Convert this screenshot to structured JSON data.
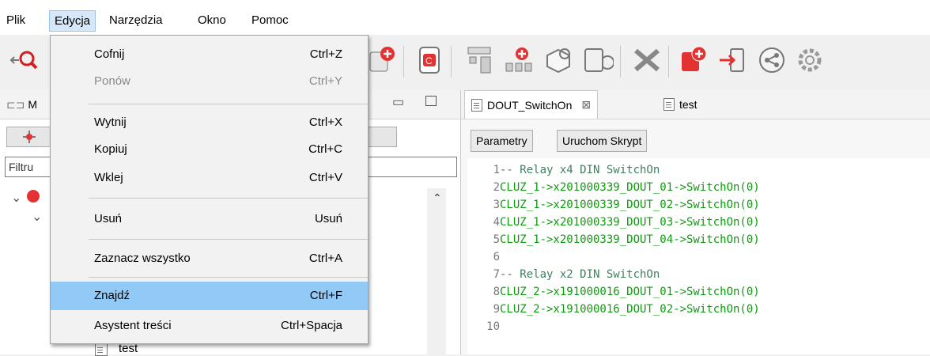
{
  "menubar": {
    "items": [
      "Plik",
      "Edycja",
      "Narzędzia",
      "Okno",
      "Pomoc"
    ]
  },
  "colors": {
    "menu_highlight": "#91c9f7",
    "code_green": "#0f9b0f",
    "comment_green": "#3f7f5f",
    "accent_red": "#e23232"
  },
  "toolbar": {
    "icons": [
      "search-tool-icon",
      "add-device-icon",
      "controller-icon",
      "modules-icon",
      "network-icon",
      "cube-settings-icon",
      "device-sync-icon",
      "remove-icon",
      "add-object-icon",
      "import-icon",
      "share-cloud-icon",
      "settings-icon"
    ]
  },
  "left_panel": {
    "tab_label": "M",
    "filter_label": "Filtru",
    "tree_item_label": "test"
  },
  "edit_menu": {
    "items": [
      {
        "label": "Cofnij",
        "shortcut": "Ctrl+Z",
        "enabled": true
      },
      {
        "label": "Ponów",
        "shortcut": "Ctrl+Y",
        "enabled": false
      },
      {
        "label": "Wytnij",
        "shortcut": "Ctrl+X",
        "enabled": true
      },
      {
        "label": "Kopiuj",
        "shortcut": "Ctrl+C",
        "enabled": true
      },
      {
        "label": "Wklej",
        "shortcut": "Ctrl+V",
        "enabled": true
      },
      {
        "label": "Usuń",
        "shortcut": "Usuń",
        "enabled": true
      },
      {
        "label": "Zaznacz wszystko",
        "shortcut": "Ctrl+A",
        "enabled": true
      },
      {
        "label": "Znajdź",
        "shortcut": "Ctrl+F",
        "enabled": true,
        "highlighted": true
      },
      {
        "label": "Asystent treści",
        "shortcut": "Ctrl+Spacja",
        "enabled": true
      }
    ]
  },
  "editor": {
    "tabs": [
      {
        "label": "DOUT_SwitchOn",
        "close": "⊠",
        "active": true
      },
      {
        "label": "test",
        "active": false
      }
    ],
    "buttons": {
      "params": "Parametry",
      "run": "Uruchom Skrypt"
    },
    "lines": [
      {
        "num": "1",
        "text": "-- Relay x4 DIN SwitchOn",
        "kind": "comment"
      },
      {
        "num": "2",
        "text": "CLUZ_1->x201000339_DOUT_01->SwitchOn(0)",
        "kind": "code"
      },
      {
        "num": "3",
        "text": "CLUZ_1->x201000339_DOUT_02->SwitchOn(0)",
        "kind": "code"
      },
      {
        "num": "4",
        "text": "CLUZ_1->x201000339_DOUT_03->SwitchOn(0)",
        "kind": "code"
      },
      {
        "num": "5",
        "text": "CLUZ_1->x201000339_DOUT_04->SwitchOn(0)",
        "kind": "code"
      },
      {
        "num": "6",
        "text": "",
        "kind": "code"
      },
      {
        "num": "7",
        "text": "-- Relay x2 DIN SwitchOn",
        "kind": "comment"
      },
      {
        "num": "8",
        "text": "CLUZ_2->x191000016_DOUT_01->SwitchOn(0)",
        "kind": "code"
      },
      {
        "num": "9",
        "text": "CLUZ_2->x191000016_DOUT_02->SwitchOn(0)",
        "kind": "code"
      },
      {
        "num": "10",
        "text": "",
        "kind": "code"
      }
    ]
  }
}
